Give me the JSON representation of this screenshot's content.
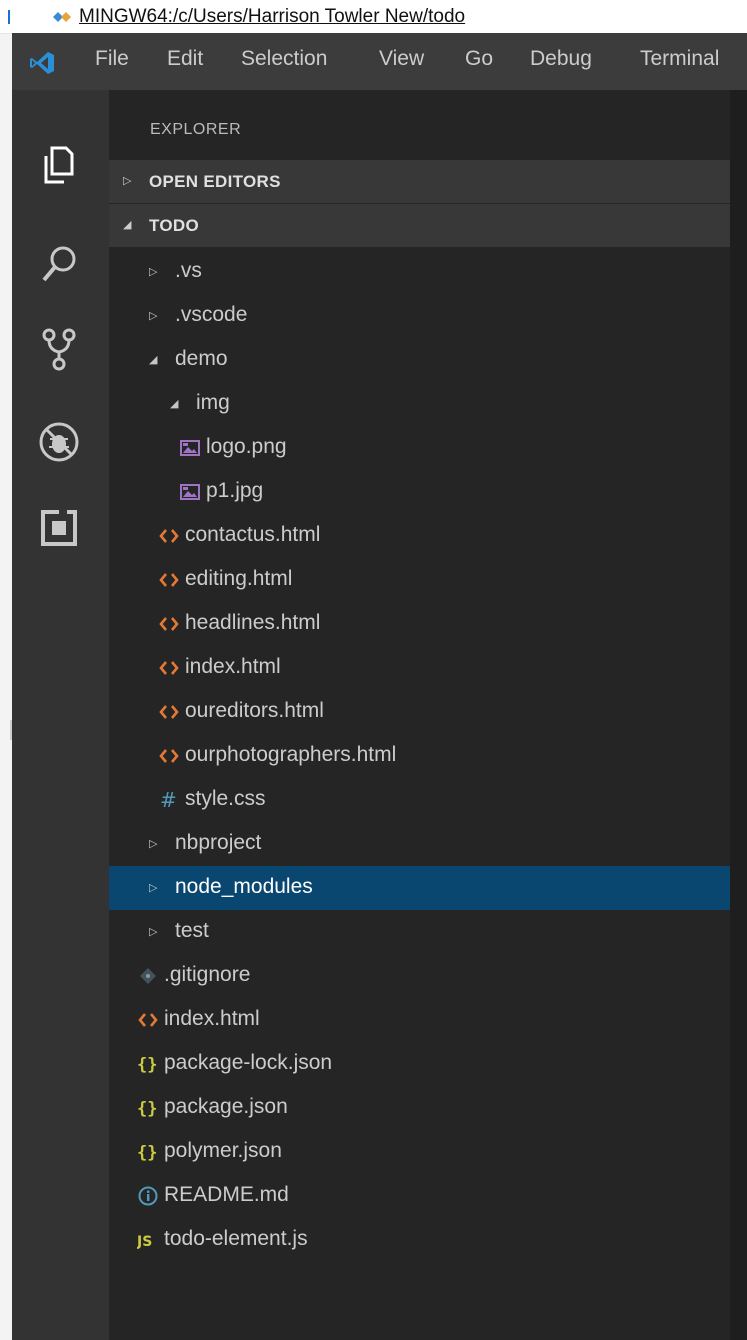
{
  "terminal": {
    "title": "MINGW64:/c/Users/Harrison Towler New/todo"
  },
  "menu": [
    "File",
    "Edit",
    "Selection",
    "View",
    "Go",
    "Debug",
    "Terminal"
  ],
  "activity_icons": [
    "explorer-icon",
    "search-icon",
    "source-control-icon",
    "debug-icon",
    "extensions-icon"
  ],
  "explorer": {
    "header": "EXPLORER",
    "open_editors": "OPEN EDITORS",
    "project": "TODO",
    "items": [
      {
        "name": ".vs",
        "type": "folder",
        "state": "collapsed"
      },
      {
        "name": ".vscode",
        "type": "folder",
        "state": "collapsed"
      },
      {
        "name": "demo",
        "type": "folder",
        "state": "expanded"
      },
      {
        "name": "img",
        "type": "folder",
        "state": "expanded"
      },
      {
        "name": "logo.png",
        "type": "image"
      },
      {
        "name": "p1.jpg",
        "type": "image"
      },
      {
        "name": "contactus.html",
        "type": "html"
      },
      {
        "name": "editing.html",
        "type": "html"
      },
      {
        "name": "headlines.html",
        "type": "html"
      },
      {
        "name": "index.html",
        "type": "html"
      },
      {
        "name": "oureditors.html",
        "type": "html"
      },
      {
        "name": "ourphotographers.html",
        "type": "html"
      },
      {
        "name": "style.css",
        "type": "css"
      },
      {
        "name": "nbproject",
        "type": "folder",
        "state": "collapsed"
      },
      {
        "name": "node_modules",
        "type": "folder",
        "state": "collapsed",
        "selected": true
      },
      {
        "name": "test",
        "type": "folder",
        "state": "collapsed"
      },
      {
        "name": ".gitignore",
        "type": "git"
      },
      {
        "name": "index.html",
        "type": "html"
      },
      {
        "name": "package-lock.json",
        "type": "json"
      },
      {
        "name": "package.json",
        "type": "json"
      },
      {
        "name": "polymer.json",
        "type": "json"
      },
      {
        "name": "README.md",
        "type": "info"
      },
      {
        "name": "todo-element.js",
        "type": "js"
      }
    ]
  },
  "colors": {
    "selection": "#094771",
    "html_icon": "#e37933",
    "json_icon": "#cbcb41",
    "css_icon": "#519aba",
    "image_icon": "#a074c4",
    "js_icon": "#cbcb41"
  }
}
